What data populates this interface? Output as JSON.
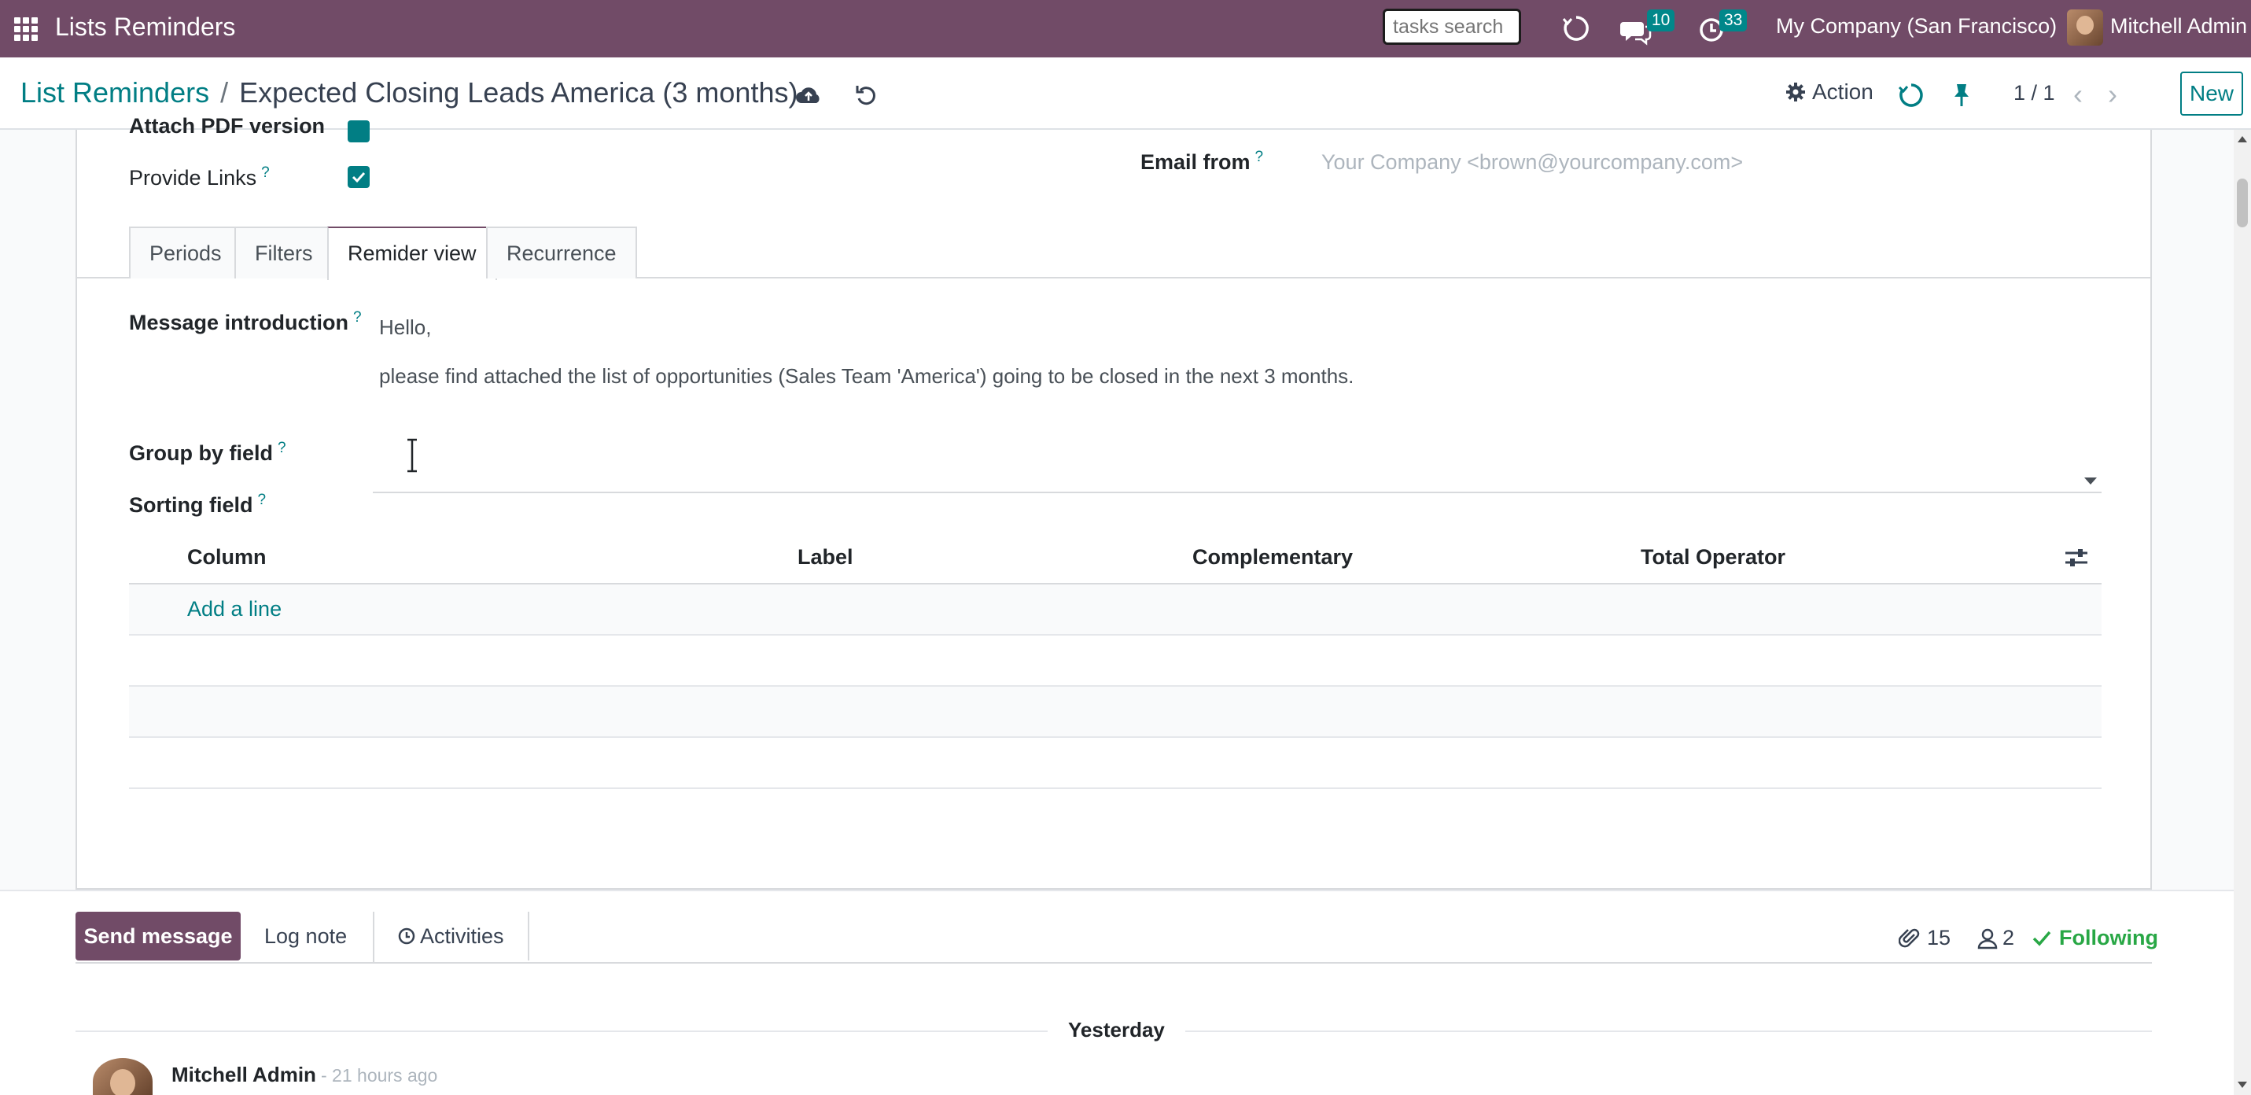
{
  "navbar": {
    "app_title": "Lists Reminders",
    "search_placeholder": "tasks search",
    "messages_count": "10",
    "activities_count": "33",
    "company": "My Company (San Francisco)",
    "user": "Mitchell Admin"
  },
  "control_panel": {
    "breadcrumb_parent": "List Reminders",
    "breadcrumb_separator": "/",
    "breadcrumb_current": "Expected Closing Leads America (3 months)",
    "action_label": "Action",
    "pager": "1 / 1",
    "new_label": "New"
  },
  "form": {
    "attach_pdf_label": "Attach PDF version",
    "provide_links_label": "Provide Links",
    "email_from_label": "Email from",
    "email_from_placeholder": "Your Company <brown@yourcompany.com>",
    "help_mark": "?",
    "tabs": [
      {
        "label": "Periods"
      },
      {
        "label": "Filters"
      },
      {
        "label": "Remider view"
      },
      {
        "label": "Recurrence"
      }
    ],
    "message_intro_label": "Message introduction",
    "message_intro_lines": [
      "Hello,",
      "please find attached the list of opportunities (Sales Team 'America') going to be closed in the next 3 months."
    ],
    "group_by_label": "Group by field",
    "sorting_label": "Sorting field",
    "table": {
      "columns": [
        "Column",
        "Label",
        "Complementary",
        "Total Operator"
      ],
      "add_line": "Add a line"
    }
  },
  "chatter": {
    "send_message": "Send message",
    "log_note": "Log note",
    "activities": "Activities",
    "attachments_count": "15",
    "followers_count": "2",
    "following": "Following",
    "date_separator": "Yesterday",
    "message_author": "Mitchell Admin",
    "message_time": "- 21 hours ago"
  },
  "colors": {
    "brand": "#714b67",
    "accent": "#017e84",
    "badge": "#00878a"
  }
}
